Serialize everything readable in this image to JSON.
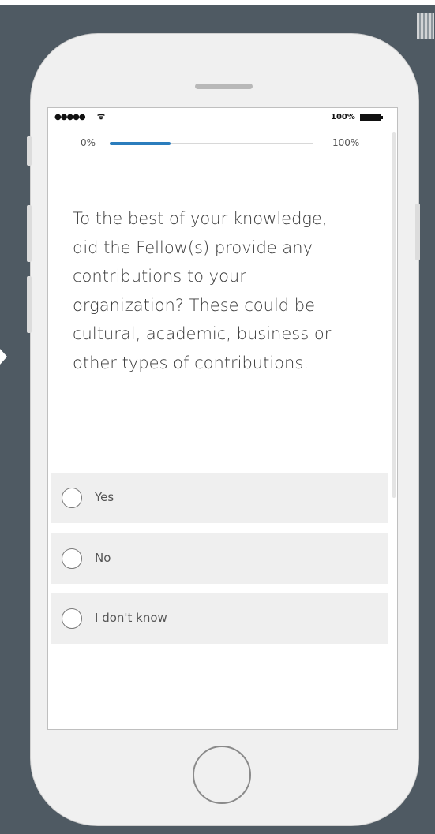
{
  "status_bar": {
    "signal": "●●●●●",
    "wifi_icon": "wifi-icon",
    "battery_percent": "100%"
  },
  "progress": {
    "start_label": "0%",
    "end_label": "100%",
    "fraction": 0.3
  },
  "question": {
    "text": "To the best of your knowledge, did the Fellow(s) provide any contributions to your organization? These could be cultural, academic, business or other types of contributions."
  },
  "options": [
    {
      "label": "Yes"
    },
    {
      "label": "No"
    },
    {
      "label": "I don't know"
    }
  ],
  "colors": {
    "background": "#4f5a63",
    "phone_body": "#f0f0f0",
    "progress_accent": "#2b7dbd"
  }
}
